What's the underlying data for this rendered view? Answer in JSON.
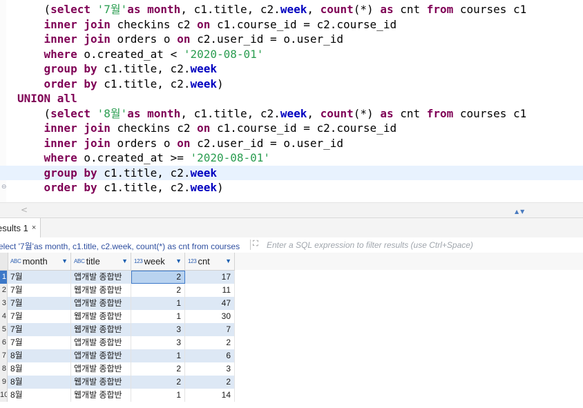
{
  "editor": {
    "lines": [
      {
        "indent": "    ",
        "tokens": [
          [
            "sep",
            "("
          ],
          [
            "kw",
            "select"
          ],
          [
            "sep",
            " "
          ],
          [
            "str",
            "'7월'"
          ],
          [
            "kw",
            "as"
          ],
          [
            "sep",
            " "
          ],
          [
            "kw",
            "month"
          ],
          [
            "sep",
            ", c1.title, c2."
          ],
          [
            "col",
            "week"
          ],
          [
            "sep",
            ", "
          ],
          [
            "fn",
            "count"
          ],
          [
            "sep",
            "(*) "
          ],
          [
            "kw",
            "as"
          ],
          [
            "sep",
            " cnt "
          ],
          [
            "kw",
            "from"
          ],
          [
            "sep",
            " courses c1"
          ]
        ]
      },
      {
        "indent": "    ",
        "tokens": [
          [
            "kw",
            "inner join"
          ],
          [
            "sep",
            " checkins c2 "
          ],
          [
            "kw",
            "on"
          ],
          [
            "sep",
            " c1.course_id = c2.course_id"
          ]
        ]
      },
      {
        "indent": "    ",
        "tokens": [
          [
            "kw",
            "inner join"
          ],
          [
            "sep",
            " orders o "
          ],
          [
            "kw",
            "on"
          ],
          [
            "sep",
            " c2.user_id = o.user_id"
          ]
        ]
      },
      {
        "indent": "    ",
        "tokens": [
          [
            "kw",
            "where"
          ],
          [
            "sep",
            " o.created_at < "
          ],
          [
            "str",
            "'2020-08-01'"
          ]
        ]
      },
      {
        "indent": "    ",
        "tokens": [
          [
            "kw",
            "group by"
          ],
          [
            "sep",
            " c1.title, c2."
          ],
          [
            "col",
            "week"
          ]
        ]
      },
      {
        "indent": "    ",
        "tokens": [
          [
            "kw",
            "order by"
          ],
          [
            "sep",
            " c1.title, c2."
          ],
          [
            "col",
            "week"
          ],
          [
            "sep",
            ")"
          ]
        ]
      },
      {
        "indent": "",
        "tokens": [
          [
            "kw",
            "UNION all"
          ]
        ]
      },
      {
        "indent": "    ",
        "tokens": [
          [
            "sep",
            "("
          ],
          [
            "kw",
            "select"
          ],
          [
            "sep",
            " "
          ],
          [
            "str",
            "'8월'"
          ],
          [
            "kw",
            "as"
          ],
          [
            "sep",
            " "
          ],
          [
            "kw",
            "month"
          ],
          [
            "sep",
            ", c1.title, c2."
          ],
          [
            "col",
            "week"
          ],
          [
            "sep",
            ", "
          ],
          [
            "fn",
            "count"
          ],
          [
            "sep",
            "(*) "
          ],
          [
            "kw",
            "as"
          ],
          [
            "sep",
            " cnt "
          ],
          [
            "kw",
            "from"
          ],
          [
            "sep",
            " courses c1"
          ]
        ]
      },
      {
        "indent": "    ",
        "tokens": [
          [
            "kw",
            "inner join"
          ],
          [
            "sep",
            " checkins c2 "
          ],
          [
            "kw",
            "on"
          ],
          [
            "sep",
            " c1.course_id = c2.course_id"
          ]
        ]
      },
      {
        "indent": "    ",
        "tokens": [
          [
            "kw",
            "inner join"
          ],
          [
            "sep",
            " orders o "
          ],
          [
            "kw",
            "on"
          ],
          [
            "sep",
            " c2.user_id = o.user_id"
          ]
        ]
      },
      {
        "indent": "    ",
        "tokens": [
          [
            "kw",
            "where"
          ],
          [
            "sep",
            " o.created_at >= "
          ],
          [
            "str",
            "'2020-08-01'"
          ]
        ]
      },
      {
        "indent": "    ",
        "tokens": [
          [
            "kw",
            "group by"
          ],
          [
            "sep",
            " c1.title, c2."
          ],
          [
            "col",
            "week"
          ]
        ],
        "highlight": true
      },
      {
        "indent": "    ",
        "tokens": [
          [
            "kw",
            "order by"
          ],
          [
            "sep",
            " c1.title, c2."
          ],
          [
            "col",
            "week"
          ],
          [
            "sep",
            ")"
          ]
        ]
      }
    ],
    "scroll_left_glyph": "<",
    "collapse_glyph": "▲▼"
  },
  "results": {
    "tab_label": "esults 1",
    "tab_close": "×",
    "query_text": "elect '7월'as month, c1.title, c2.week, count(*) as cnt from courses",
    "filter_placeholder": "Enter a SQL expression to filter results (use Ctrl+Space)",
    "expand_glyph": "⛶",
    "columns": [
      {
        "type": "ABC",
        "name": "month"
      },
      {
        "type": "ABC",
        "name": "title"
      },
      {
        "type": "123",
        "name": "week"
      },
      {
        "type": "123",
        "name": "cnt"
      }
    ],
    "sort_glyph": "▼",
    "rows": [
      {
        "n": "1",
        "month": "7월",
        "title": "앱개발 종합반",
        "week": "2",
        "cnt": "17"
      },
      {
        "n": "2",
        "month": "7월",
        "title": "웹개발 종합반",
        "week": "2",
        "cnt": "11"
      },
      {
        "n": "3",
        "month": "7월",
        "title": "앱개발 종합반",
        "week": "1",
        "cnt": "47"
      },
      {
        "n": "4",
        "month": "7월",
        "title": "웹개발 종합반",
        "week": "1",
        "cnt": "30"
      },
      {
        "n": "5",
        "month": "7월",
        "title": "웹개발 종합반",
        "week": "3",
        "cnt": "7"
      },
      {
        "n": "6",
        "month": "7월",
        "title": "앱개발 종합반",
        "week": "3",
        "cnt": "2"
      },
      {
        "n": "7",
        "month": "8월",
        "title": "앱개발 종합반",
        "week": "1",
        "cnt": "6"
      },
      {
        "n": "8",
        "month": "8월",
        "title": "앱개발 종합반",
        "week": "2",
        "cnt": "3"
      },
      {
        "n": "9",
        "month": "8월",
        "title": "웹개발 종합반",
        "week": "2",
        "cnt": "2"
      },
      {
        "n": "10",
        "month": "8월",
        "title": "웹개발 종합반",
        "week": "1",
        "cnt": "14"
      }
    ]
  }
}
